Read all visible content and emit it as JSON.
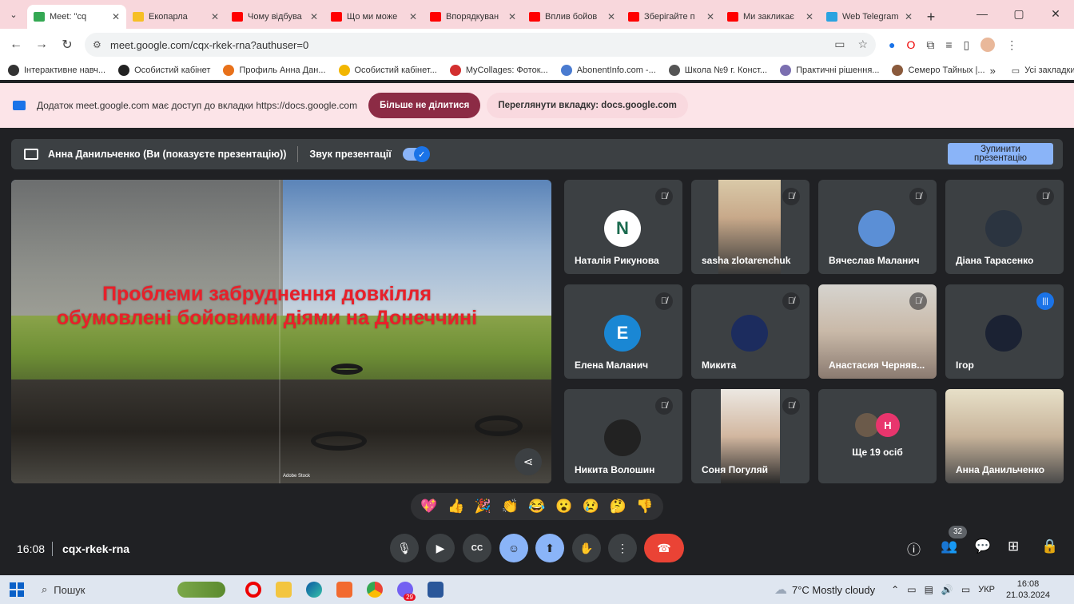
{
  "tabs": [
    {
      "label": "Meet: \"cq",
      "color": "#34a853",
      "active": true
    },
    {
      "label": "Екопарла",
      "color": "#f6bf26",
      "active": false
    },
    {
      "label": "Чому відбува",
      "color": "#ff0000",
      "active": false
    },
    {
      "label": "Що ми може",
      "color": "#ff0000",
      "active": false
    },
    {
      "label": "Впорядкуван",
      "color": "#ff0000",
      "active": false
    },
    {
      "label": "Вплив бойов",
      "color": "#ff0000",
      "active": false
    },
    {
      "label": "Зберігайте п",
      "color": "#ff0000",
      "active": false
    },
    {
      "label": "Ми закликає",
      "color": "#ff0000",
      "active": false
    },
    {
      "label": "Web Telegram",
      "color": "#2aa3e0",
      "active": false
    }
  ],
  "address": {
    "url": "meet.google.com/cqx-rkek-rna?authuser=0"
  },
  "bookmarks": [
    {
      "label": "Інтерактивне навч...",
      "color": "#333"
    },
    {
      "label": "Особистий кабінет",
      "color": "#222"
    },
    {
      "label": "Профиль Анна Дан...",
      "color": "#e8711a"
    },
    {
      "label": "Особистий кабінет...",
      "color": "#f2b600"
    },
    {
      "label": "MyCollages: Фоток...",
      "color": "#d32f2f"
    },
    {
      "label": "AbonentInfo.com -...",
      "color": "#4a7bd0"
    },
    {
      "label": "Школа №9 г. Конст...",
      "color": "#555"
    },
    {
      "label": "Практичні рішення...",
      "color": "#7b6fb0"
    },
    {
      "label": "Семеро Тайных |...",
      "color": "#8a5a3c"
    }
  ],
  "bookmarks_all": "Усі закладки",
  "infobar": {
    "text": "Додаток meet.google.com має доступ до вкладки https://docs.google.com",
    "stop_sharing": "Більше не ділитися",
    "view_tab": "Переглянути вкладку: docs.google.com"
  },
  "presenting": {
    "label": "Анна Данильченко (Ви (показуєте презентацію))",
    "audio_label": "Звук презентації",
    "audio_on": true,
    "stop_line1": "Зупинити",
    "stop_line2": "презентацію"
  },
  "slide": {
    "title": "Проблеми забруднення довкілля обумовлені бойовими діями на Донеччині",
    "watermark": "Adobe Stock"
  },
  "participants": [
    {
      "name": "Наталія Рикунова",
      "type": "avatar",
      "letter": "N",
      "color": "#ffffff",
      "muted": true
    },
    {
      "name": "sasha zlotarenchuk",
      "type": "video",
      "muted": true
    },
    {
      "name": "Вячеслав Маланич",
      "type": "avatar",
      "letter": "",
      "color": "#5b8fd6",
      "muted": true
    },
    {
      "name": "Діана Тарасенко",
      "type": "avatar",
      "letter": "",
      "color": "#2b3440",
      "muted": true
    },
    {
      "name": "Елена Маланич",
      "type": "avatar",
      "letter": "E",
      "color": "#1a87d4",
      "muted": true
    },
    {
      "name": "Микита",
      "type": "avatar",
      "letter": "",
      "color": "#1c2c5e",
      "muted": true
    },
    {
      "name": "Анастасия Черняв...",
      "type": "video",
      "muted": true
    },
    {
      "name": "Ігор",
      "type": "avatar",
      "letter": "",
      "color": "#1b2233",
      "muted": false
    },
    {
      "name": "Никита Волошин",
      "type": "avatar",
      "letter": "",
      "color": "#222",
      "muted": true
    },
    {
      "name": "Соня Погуляй",
      "type": "video",
      "muted": true
    },
    {
      "name": "Ще 19 осіб",
      "type": "more",
      "letter": "Н",
      "color": "#e8356d",
      "muted": false
    },
    {
      "name": "Анна Данильченко",
      "type": "video",
      "muted": false
    }
  ],
  "reactions": [
    "💖",
    "👍",
    "🎉",
    "👏",
    "😂",
    "😮",
    "😢",
    "🤔",
    "👎"
  ],
  "meeting": {
    "time": "16:08",
    "code": "cqx-rkek-rna",
    "participant_count": "32"
  },
  "taskbar": {
    "search": "Пошук",
    "weather": "7°C  Mostly cloudy",
    "lang": "УКР",
    "time": "16:08",
    "date": "21.03.2024",
    "badge": "29"
  }
}
